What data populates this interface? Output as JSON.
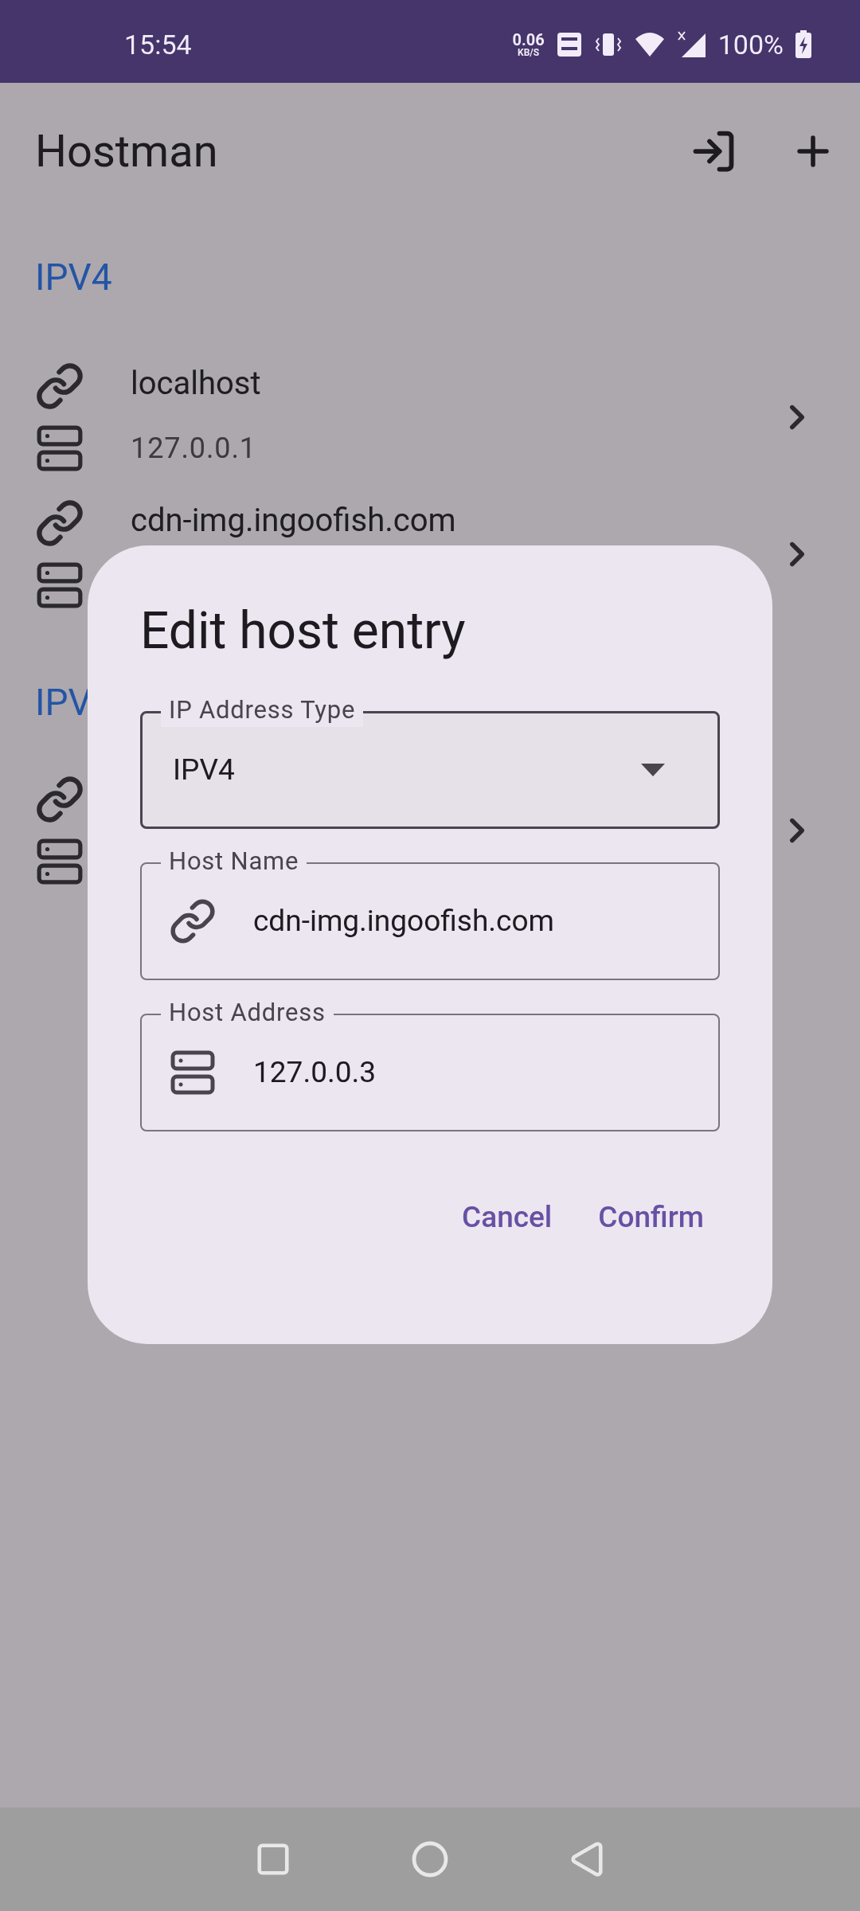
{
  "status_bar": {
    "time": "15:54",
    "speed": "0.06",
    "speed_unit": "KB/S",
    "battery": "100%"
  },
  "app_bar": {
    "title": "Hostman"
  },
  "sections": [
    {
      "header": "IPV4",
      "entries": [
        {
          "kind": "host",
          "name": "localhost",
          "address": "127.0.0.1"
        },
        {
          "kind": "host",
          "name": "cdn-img.ingoofish.com"
        }
      ]
    },
    {
      "header": "IPV",
      "entries": [
        {
          "kind": "host"
        }
      ]
    }
  ],
  "dialog": {
    "title": "Edit host entry",
    "fields": [
      {
        "kind": "dropdown",
        "label": "IP Address Type",
        "value": "IPV4"
      },
      {
        "kind": "hostname",
        "label": "Host Name",
        "value": "cdn-img.ingoofish.com"
      },
      {
        "kind": "address",
        "label": "Host Address",
        "value": "127.0.0.3"
      }
    ],
    "buttons": [
      "Cancel",
      "Confirm"
    ]
  }
}
